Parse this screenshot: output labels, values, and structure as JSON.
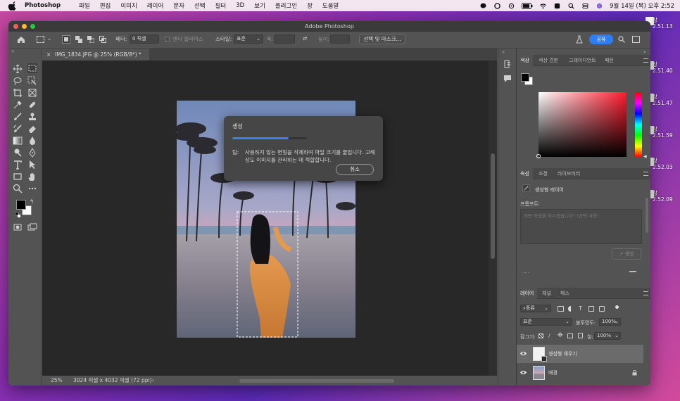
{
  "menubar": {
    "app_name": "Photoshop",
    "items": [
      "파일",
      "편집",
      "이미지",
      "레이어",
      "문자",
      "선택",
      "필터",
      "3D",
      "보기",
      "플러그인",
      "창",
      "도움말"
    ],
    "datetime": "9월 14일 (목) 오후 2:52"
  },
  "desktop": {
    "files": [
      "상\n2.51.13",
      "상\n2.51.40",
      "상\n2.51.47",
      "상\n2.51.59",
      "상\n2.52.03",
      "상\n2.52.09"
    ]
  },
  "window": {
    "title": "Adobe Photoshop"
  },
  "options": {
    "feather_label": "페더:",
    "feather_value": "0 픽셀",
    "antialias_label": "앤티 앨리어스",
    "style_label": "스타일:",
    "style_value": "표준",
    "width_label": "폭:",
    "height_label": "높이:",
    "select_mask_button": "선택 및 마스크...",
    "share_button": "공유"
  },
  "document": {
    "tab_title": "IMG_1834.JPG @ 25% (RGB/8*) *",
    "zoom": "25%",
    "info": "3024 픽셀 x 4032 픽셀 (72 ppi)"
  },
  "dialog": {
    "title": "생성",
    "progress": 0.75,
    "tip_label": "팁:",
    "tip_text": "사용하지 않는 변형을 삭제하여 파일 크기를 줄입니다. 고해상도 이미지를 관리하는 데 적합합니다.",
    "cancel_button": "취소"
  },
  "color_panel": {
    "tabs": [
      "색상",
      "색상 견본",
      "그레이디언트",
      "패턴"
    ],
    "foreground": "#000000",
    "background": "#ffffff"
  },
  "properties_panel": {
    "tabs": [
      "속성",
      "조정",
      "라이브러리"
    ],
    "layer_type": "생성형 레이어",
    "prompt_label": "프롬프트:",
    "prompt_placeholder": "어떤 작업을 하시겠습니까? (선택 사항)",
    "generate_button": "생성",
    "more": "....."
  },
  "layers_panel": {
    "tabs": [
      "레이어",
      "채널",
      "패스"
    ],
    "filter_kind": "종류",
    "blend_mode": "표준",
    "opacity_label": "불투명도:",
    "opacity_value": "100%",
    "lock_label": "잠그기:",
    "fill_label": "칠:",
    "fill_value": "100%",
    "layers": [
      {
        "name": "생성형 채우기",
        "selected": true
      },
      {
        "name": "배경",
        "locked": true
      }
    ]
  }
}
